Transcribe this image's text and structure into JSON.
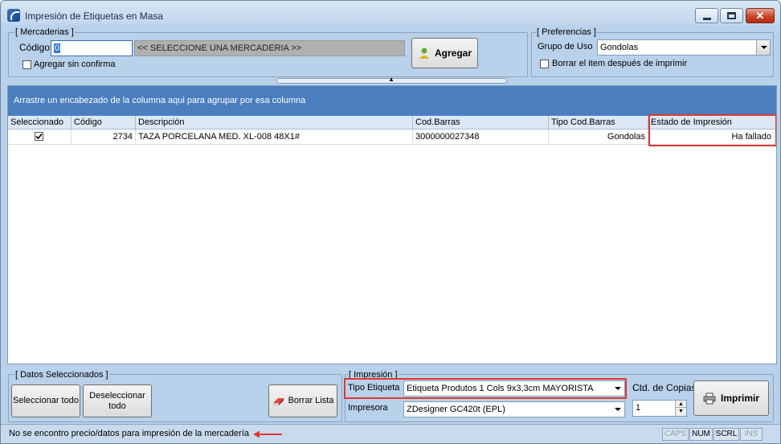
{
  "window": {
    "title": "Impresión de Etiquetas en Masa"
  },
  "mercaderias": {
    "group_label": "[ Mercaderias ]",
    "codigo_label": "Código",
    "codigo_value": "0",
    "seleccione_text": "<< SELECCIONE UNA MERCADERIA >>",
    "agregar_sin_confirma_label": "Agregar sin confirma",
    "agregar_button": "Agregar"
  },
  "preferencias": {
    "group_label": "[ Preferencias ]",
    "grupo_de_uso_label": "Grupo de Uso",
    "grupo_de_uso_value": "Gondolas",
    "borrar_item_label": "Borrar el item después de imprimir"
  },
  "grid": {
    "group_panel_text": "Arrastre un encabezado de la columna aqui para agrupar por esa columna",
    "columns": [
      "Seleccionado",
      "Código",
      "Descripción",
      "Cod.Barras",
      "Tipo Cod.Barras",
      "Estado de Impresión"
    ],
    "rows": [
      {
        "codigo": "2734",
        "descripcion": "TAZA PORCELANA MED. XL-008 48X1#",
        "cod_barras": "3000000027348",
        "tipo_cod_barras": "Gondolas",
        "estado": "Ha fallado"
      }
    ]
  },
  "datos_seleccionados": {
    "group_label": "[ Datos Seleccionados ]",
    "seleccionar_todo": "Seleccionar todo",
    "deseleccionar_todo": "Deseleccionar todo",
    "borrar_lista": "Borrar Lista"
  },
  "impresion": {
    "group_label": "[ Impresión ]",
    "tipo_etiqueta_label": "Tipo Etiqueta",
    "tipo_etiqueta_value": "Etiqueta Produtos 1 Cols 9x3,3cm MAYORISTA",
    "impresora_label": "Impresora",
    "impresora_value": "ZDesigner GC420t (EPL)",
    "ctd_copias_label": "Ctd. de Copias",
    "ctd_copias_value": "1",
    "imprimir_button": "Imprimir"
  },
  "status_bar": {
    "message": "No se encontro precio/datos para impresión de la mercadería",
    "indicators": [
      "CAPS",
      "NUM",
      "SCRL",
      "INS"
    ]
  },
  "colors": {
    "highlight": "#e0392f",
    "group_panel": "#4a7ebf",
    "window_bg": "#b9d1ea"
  }
}
